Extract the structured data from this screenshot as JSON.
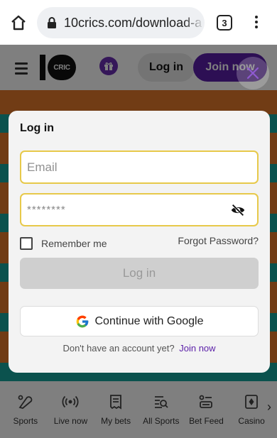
{
  "browser": {
    "url": "10crics.com/download-a",
    "tab_count": "3"
  },
  "site": {
    "logo_text": "CRIC",
    "login_label": "Log in",
    "join_label": "Join now",
    "nav": [
      {
        "label": "Sports",
        "icon": "sports-icon"
      },
      {
        "label": "Live now",
        "icon": "live-broadcast-icon"
      },
      {
        "label": "My bets",
        "icon": "bet-slip-icon"
      },
      {
        "label": "All Sports",
        "icon": "all-sports-icon"
      },
      {
        "label": "Bet Feed",
        "icon": "bet-feed-icon"
      },
      {
        "label": "Casino",
        "icon": "casino-icon"
      }
    ]
  },
  "modal": {
    "title": "Log in",
    "email_placeholder": "Email",
    "password_masked": "********",
    "remember_label": "Remember me",
    "forgot_label": "Forgot Password?",
    "submit_label": "Log in",
    "google_label": "Continue with Google",
    "signup_prompt": "Don't have an account yet?",
    "signup_link": "Join now"
  },
  "colors": {
    "brand_purple": "#5b1fa8",
    "field_border": "#e7c94a",
    "disabled_button": "#cfcfcf"
  }
}
